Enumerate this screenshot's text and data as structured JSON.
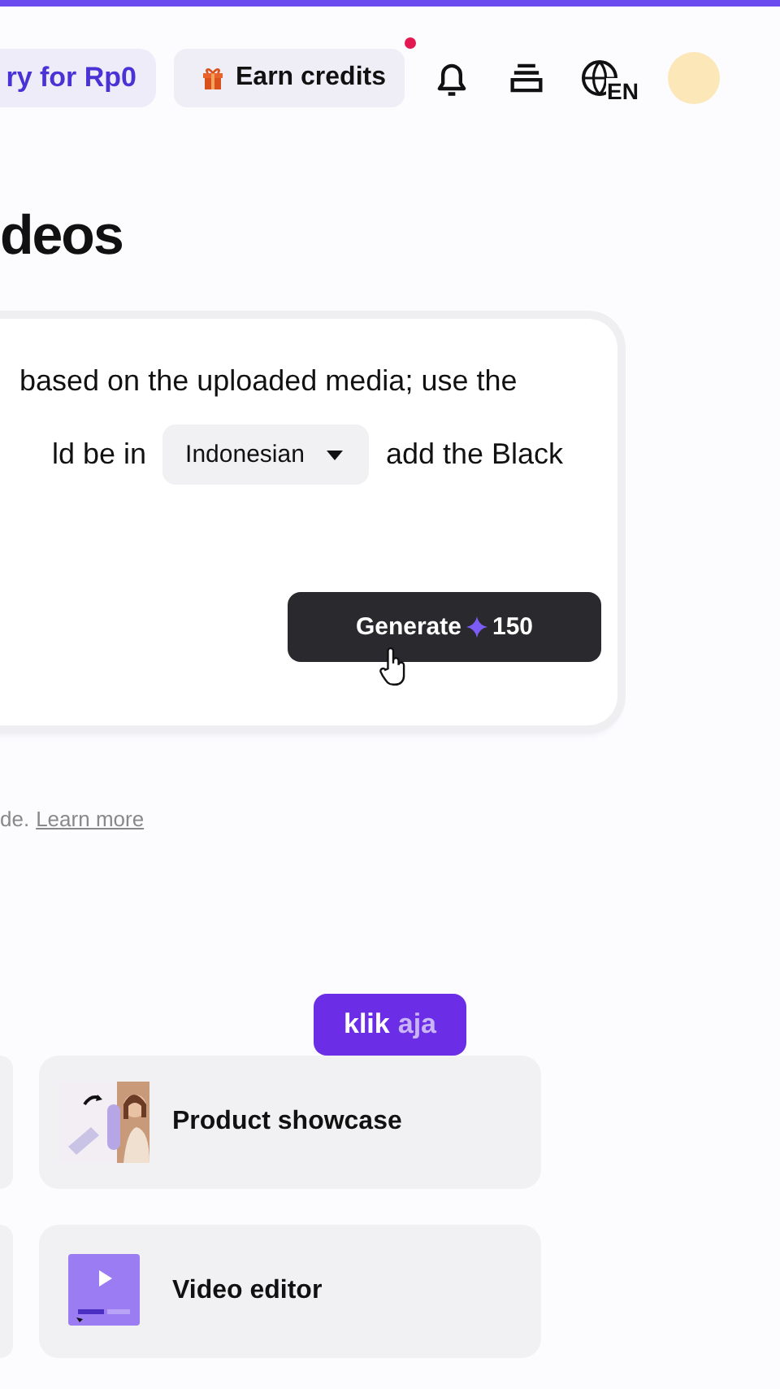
{
  "header": {
    "trial_button": "ry for Rp0",
    "earn_credits": {
      "label": "Earn credits",
      "notification": true
    },
    "language": "EN"
  },
  "title": "deos",
  "prompt": {
    "line_1": "based on the uploaded media; use the",
    "line_2_before": "ld be in",
    "language_select": "Indonesian",
    "line_2_after": "add the Black"
  },
  "generate_button": {
    "label": "Generate",
    "credits": "150"
  },
  "footnote": {
    "text": "de.",
    "link": "Learn more"
  },
  "badge": {
    "word_1": "klik",
    "word_2": "aja"
  },
  "tools": [
    {
      "kind": "picture",
      "label": "Product showcase"
    },
    {
      "kind": "video-editor",
      "label": "Video editor"
    }
  ]
}
